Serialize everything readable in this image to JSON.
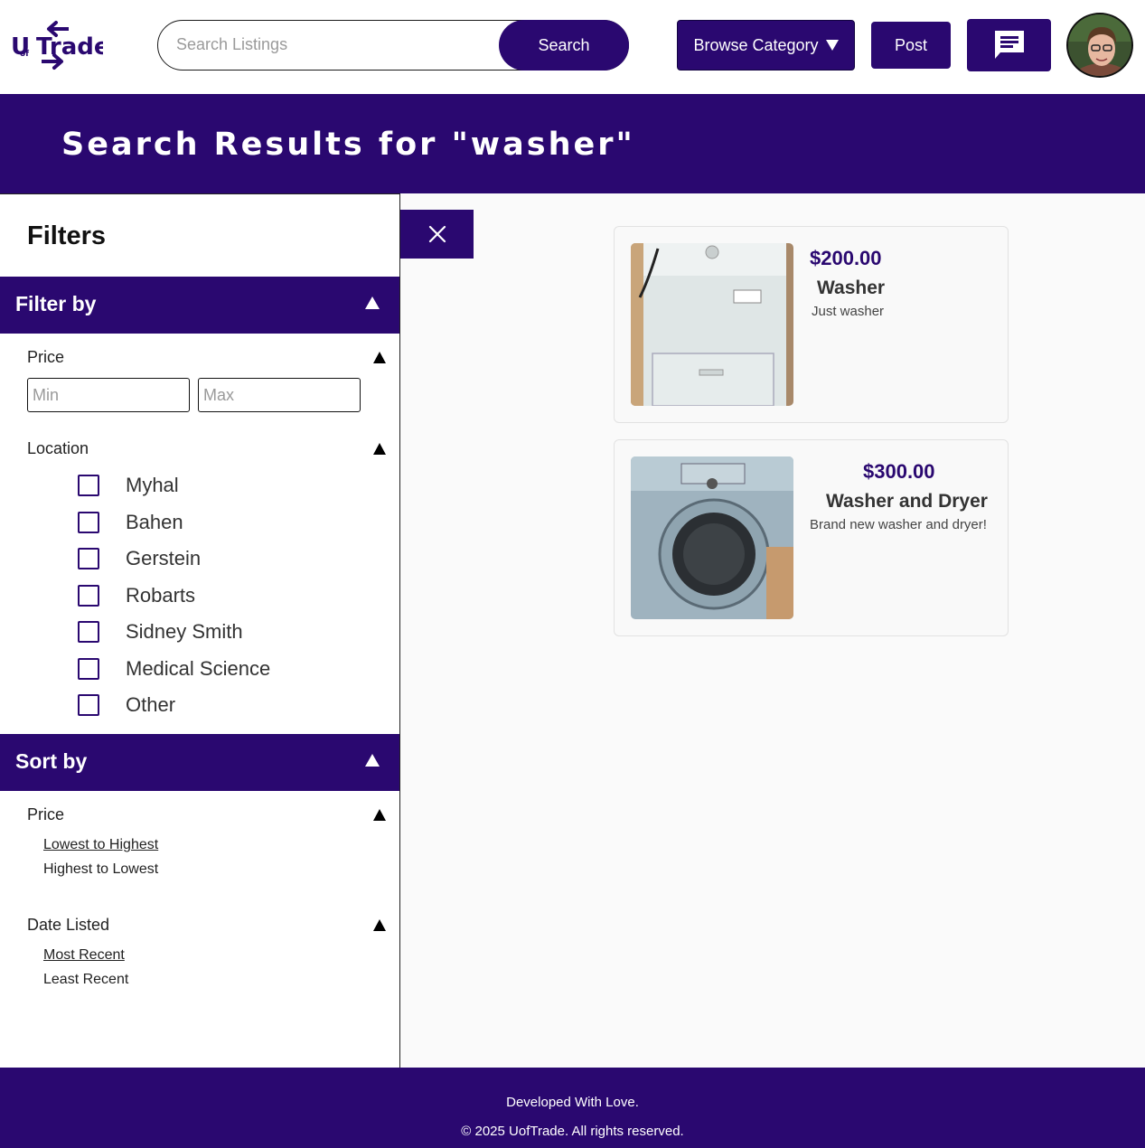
{
  "header": {
    "logo_text": "UofTrade",
    "search_placeholder": "Search Listings",
    "search_button": "Search",
    "browse_button": "Browse Category",
    "post_button": "Post",
    "chat_icon": "chat-icon",
    "avatar_icon": "user-avatar"
  },
  "banner": {
    "title": "Search Results for \"washer\""
  },
  "filters": {
    "title": "Filters",
    "filter_by": {
      "label": "Filter by",
      "price": {
        "label": "Price",
        "min_placeholder": "Min",
        "max_placeholder": "Max",
        "min_value": "",
        "max_value": ""
      },
      "location": {
        "label": "Location",
        "options": [
          {
            "label": "Myhal",
            "checked": false
          },
          {
            "label": "Bahen",
            "checked": false
          },
          {
            "label": "Gerstein",
            "checked": false
          },
          {
            "label": "Robarts",
            "checked": false
          },
          {
            "label": "Sidney Smith",
            "checked": false
          },
          {
            "label": "Medical Science",
            "checked": false
          },
          {
            "label": "Other",
            "checked": false
          }
        ]
      }
    },
    "sort_by": {
      "label": "Sort by",
      "price": {
        "label": "Price",
        "options": [
          "Lowest to Highest",
          "Highest to Lowest"
        ]
      },
      "date": {
        "label": "Date Listed",
        "options": [
          "Most Recent",
          "Least Recent"
        ]
      }
    }
  },
  "close_icon": "close-icon",
  "listings": [
    {
      "price": "$200.00",
      "title": "Washer",
      "description": "Just washer",
      "image": "washer-photo"
    },
    {
      "price": "$300.00",
      "title": "Washer and Dryer",
      "description": "Brand new washer and dryer!",
      "image": "washer-dryer-photo"
    }
  ],
  "footer": {
    "line1": "Developed With Love.",
    "line2": "© 2025 UofTrade. All rights reserved."
  },
  "colors": {
    "brand": "#2a0870",
    "background": "#fafafa",
    "text": "#222222"
  }
}
